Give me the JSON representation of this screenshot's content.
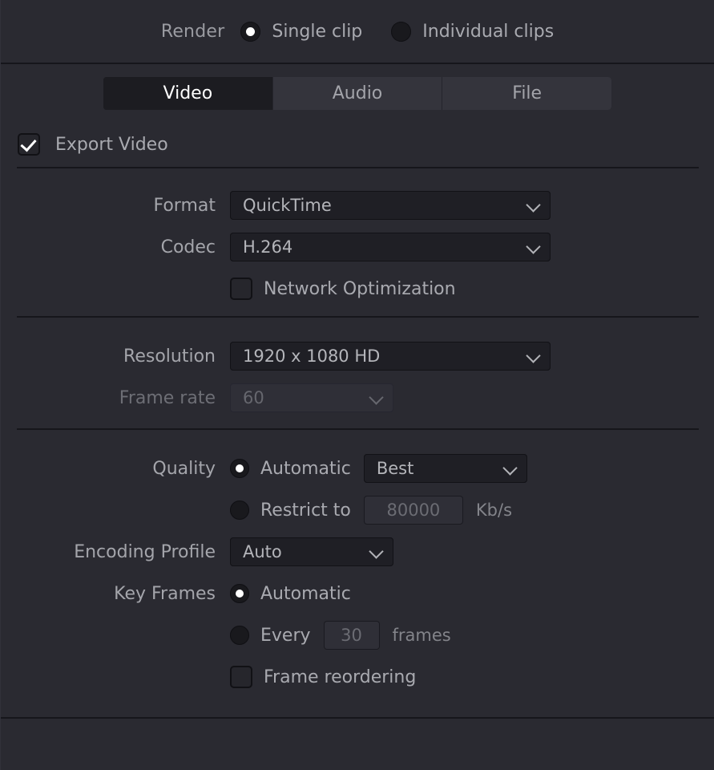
{
  "render": {
    "label": "Render",
    "options": [
      {
        "label": "Single clip",
        "selected": true
      },
      {
        "label": "Individual clips",
        "selected": false
      }
    ]
  },
  "tabs": [
    {
      "label": "Video",
      "active": true
    },
    {
      "label": "Audio",
      "active": false
    },
    {
      "label": "File",
      "active": false
    }
  ],
  "export_video": {
    "label": "Export Video",
    "checked": true
  },
  "format_section": {
    "format_label": "Format",
    "format_value": "QuickTime",
    "codec_label": "Codec",
    "codec_value": "H.264",
    "network_optimization_label": "Network Optimization",
    "network_optimization_checked": false
  },
  "resolution_section": {
    "resolution_label": "Resolution",
    "resolution_value": "1920 x 1080 HD",
    "frame_rate_label": "Frame rate",
    "frame_rate_value": "60",
    "frame_rate_disabled": true
  },
  "quality_section": {
    "quality_label": "Quality",
    "automatic_label": "Automatic",
    "automatic_selected": true,
    "quality_preset": "Best",
    "restrict_label": "Restrict to",
    "restrict_selected": false,
    "restrict_value": "80000",
    "restrict_unit": "Kb/s",
    "encoding_profile_label": "Encoding Profile",
    "encoding_profile_value": "Auto",
    "key_frames_label": "Key Frames",
    "key_frames_automatic_label": "Automatic",
    "key_frames_automatic_selected": true,
    "key_frames_every_label": "Every",
    "key_frames_every_selected": false,
    "key_frames_every_value": "30",
    "key_frames_unit": "frames",
    "frame_reordering_label": "Frame reordering",
    "frame_reordering_checked": false
  },
  "colors": {
    "background": "#2a2a31",
    "separator": "#16161b",
    "active_tab_bg": "#1c1c21",
    "dropdown_bg": "#1f1f25",
    "text": "#a9aab0",
    "text_disabled": "#6b6c73",
    "accent_white": "#ffffff"
  }
}
